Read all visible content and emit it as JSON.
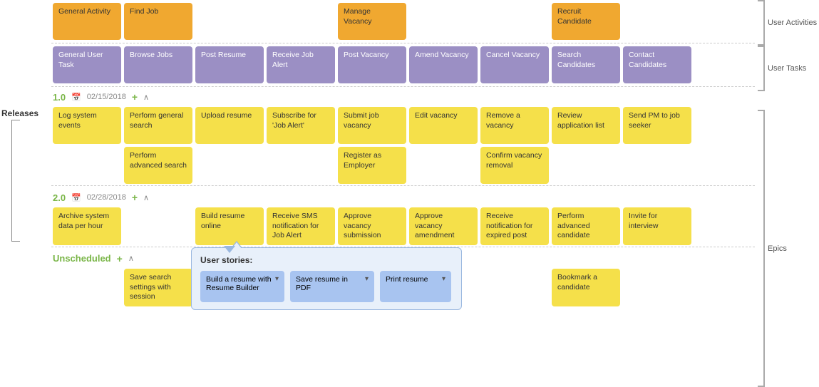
{
  "header": {
    "releases_label": "Releases",
    "right_labels": {
      "user_activities": "User Activities",
      "user_tasks": "User Tasks",
      "epics": "Epics"
    }
  },
  "user_activities": [
    {
      "id": "ua-general",
      "label": "General Activity",
      "color": "orange"
    },
    {
      "id": "ua-findjob",
      "label": "Find Job",
      "color": "orange"
    },
    {
      "id": "ua-manage",
      "label": "Manage Vacancy",
      "color": "orange"
    },
    {
      "id": "ua-recruit",
      "label": "Recruit Candidate",
      "color": "orange"
    }
  ],
  "user_tasks": [
    {
      "id": "ut-general",
      "label": "General User Task",
      "color": "purple"
    },
    {
      "id": "ut-browse",
      "label": "Browse Jobs",
      "color": "purple"
    },
    {
      "id": "ut-post-resume",
      "label": "Post Resume",
      "color": "purple"
    },
    {
      "id": "ut-receive-alert",
      "label": "Receive Job Alert",
      "color": "purple"
    },
    {
      "id": "ut-post-vacancy",
      "label": "Post Vacancy",
      "color": "purple"
    },
    {
      "id": "ut-amend",
      "label": "Amend Vacancy",
      "color": "purple"
    },
    {
      "id": "ut-cancel",
      "label": "Cancel Vacancy",
      "color": "purple"
    },
    {
      "id": "ut-search",
      "label": "Search Candidates",
      "color": "purple"
    },
    {
      "id": "ut-contact",
      "label": "Contact Candidates",
      "color": "purple"
    }
  ],
  "releases": [
    {
      "version": "1.0",
      "date": "02/15/2018",
      "epics_row1": [
        {
          "id": "e1-log",
          "label": "Log system events"
        },
        {
          "id": "e1-general-search",
          "label": "Perform general search"
        },
        {
          "id": "e1-upload",
          "label": "Upload resume"
        },
        {
          "id": "e1-subscribe",
          "label": "Subscribe for 'Job Alert'"
        },
        {
          "id": "e1-submit",
          "label": "Submit job vacancy"
        },
        {
          "id": "e1-edit",
          "label": "Edit vacancy"
        },
        {
          "id": "e1-remove",
          "label": "Remove a vacancy"
        },
        {
          "id": "e1-review",
          "label": "Review application list"
        },
        {
          "id": "e1-send-pm",
          "label": "Send PM to job seeker"
        }
      ],
      "epics_row2": [
        {
          "id": "e1-adv-search",
          "label": "Perform advanced search",
          "col": 1
        },
        {
          "id": "e1-register",
          "label": "Register as Employer",
          "col": 4
        },
        {
          "id": "e1-confirm",
          "label": "Confirm vacancy removal",
          "col": 6
        }
      ]
    },
    {
      "version": "2.0",
      "date": "02/28/2018",
      "epics_row1": [
        {
          "id": "e2-archive",
          "label": "Archive system data per hour"
        },
        {
          "id": "e2-empty1",
          "label": ""
        },
        {
          "id": "e2-build",
          "label": "Build resume online"
        },
        {
          "id": "e2-sms",
          "label": "Receive SMS notification for Job Alert"
        },
        {
          "id": "e2-approve-sub",
          "label": "Approve vacancy submission"
        },
        {
          "id": "e2-approve-amend",
          "label": "Approve vacancy amendment"
        },
        {
          "id": "e2-receive-notif",
          "label": "Receive notification for expired post"
        },
        {
          "id": "e2-perform-adv",
          "label": "Perform advanced candidate"
        },
        {
          "id": "e2-invite",
          "label": "Invite for interview"
        }
      ]
    }
  ],
  "unscheduled": {
    "label": "Unscheduled",
    "epics": [
      {
        "id": "u-save-search",
        "label": "Save search settings with session",
        "col": 1
      },
      {
        "id": "u-bookmark",
        "label": "Bookmark a candidate",
        "col": 7
      }
    ]
  },
  "popup": {
    "title": "User stories:",
    "stories": [
      {
        "id": "s-build",
        "label": "Build a resume with Resume Builder"
      },
      {
        "id": "s-save-pdf",
        "label": "Save resume in PDF"
      },
      {
        "id": "s-print",
        "label": "Print resume"
      }
    ]
  },
  "colors": {
    "orange": "#f0a830",
    "purple": "#9b8fc4",
    "yellow": "#f5e04a",
    "blue_light": "#a8c4f0",
    "green": "#7ab648"
  }
}
